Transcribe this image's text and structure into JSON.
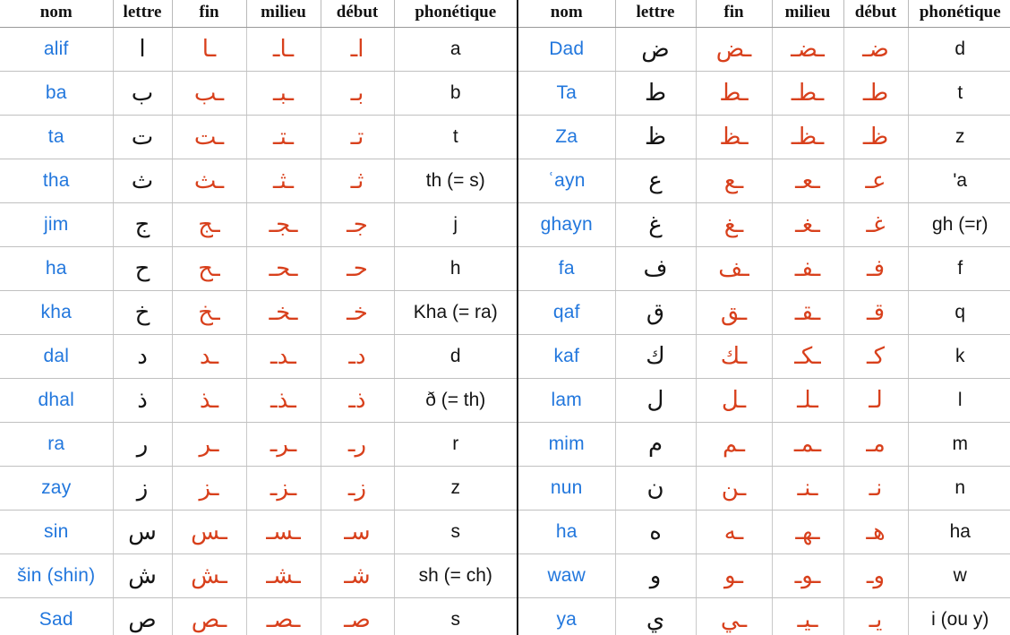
{
  "page": {
    "title": "Alphabet arabe — formes des lettres",
    "colors": {
      "name_blue": "#2277dd",
      "form_red": "#d8401c",
      "letter_black": "#141414",
      "grid_line": "#c0c0c0",
      "divider": "#1b1b1b",
      "background": "#ffffff"
    }
  },
  "headers": {
    "nom": "nom",
    "lettre": "lettre",
    "fin": "fin",
    "milieu": "milieu",
    "debut": "début",
    "phonetique": "phonétique"
  },
  "left_table": {
    "rows": [
      {
        "nom": "alif",
        "lettre": "ا",
        "fin": "ـا",
        "milieu": "ـاـ",
        "debut": "ا‍ـ",
        "phonetique": "a"
      },
      {
        "nom": "ba",
        "lettre": "ب",
        "fin": "ـب",
        "milieu": "ـبـ",
        "debut": "بـ",
        "phonetique": "b"
      },
      {
        "nom": "ta",
        "lettre": "ت",
        "fin": "ـت",
        "milieu": "ـتـ",
        "debut": "تـ",
        "phonetique": "t"
      },
      {
        "nom": "tha",
        "lettre": "ث",
        "fin": "ـث",
        "milieu": "ـثـ",
        "debut": "ثـ",
        "phonetique": "th (= s)"
      },
      {
        "nom": "jim",
        "lettre": "ج",
        "fin": "ـج",
        "milieu": "ـجـ",
        "debut": "جـ",
        "phonetique": "j"
      },
      {
        "nom": "ha",
        "lettre": "ح",
        "fin": "ـح",
        "milieu": "ـحـ",
        "debut": "حـ",
        "phonetique": "h"
      },
      {
        "nom": "kha",
        "lettre": "خ",
        "fin": "ـخ",
        "milieu": "ـخـ",
        "debut": "خـ",
        "phonetique": "Kha (= ra)"
      },
      {
        "nom": "dal",
        "lettre": "د",
        "fin": "ـد",
        "milieu": "ـدـ",
        "debut": "دـ",
        "phonetique": "d"
      },
      {
        "nom": "dhal",
        "lettre": "ذ",
        "fin": "ـذ",
        "milieu": "ـذـ",
        "debut": "ذـ",
        "phonetique": "ð (= th)"
      },
      {
        "nom": "ra",
        "lettre": "ر",
        "fin": "ـر",
        "milieu": "ـرـ",
        "debut": "رـ",
        "phonetique": "r"
      },
      {
        "nom": "zay",
        "lettre": "ز",
        "fin": "ـز",
        "milieu": "ـزـ",
        "debut": "زـ",
        "phonetique": "z"
      },
      {
        "nom": "sin",
        "lettre": "س",
        "fin": "ـس",
        "milieu": "ـسـ",
        "debut": "سـ",
        "phonetique": "s"
      },
      {
        "nom": "šin (shin)",
        "lettre": "ش",
        "fin": "ـش",
        "milieu": "ـشـ",
        "debut": "شـ",
        "phonetique": "sh (= ch)"
      },
      {
        "nom": "Sad",
        "lettre": "ص",
        "fin": "ـص",
        "milieu": "ـصـ",
        "debut": "صـ",
        "phonetique": "s"
      }
    ]
  },
  "right_table": {
    "rows": [
      {
        "nom": "Dad",
        "lettre": "ض",
        "fin": "ـض",
        "milieu": "ـضـ",
        "debut": "ضـ",
        "phonetique": "d"
      },
      {
        "nom": "Ta",
        "lettre": "ط",
        "fin": "ـط",
        "milieu": "ـطـ",
        "debut": "طـ",
        "phonetique": "t"
      },
      {
        "nom": "Za",
        "lettre": "ظ",
        "fin": "ـظ",
        "milieu": "ـظـ",
        "debut": "ظـ",
        "phonetique": "z"
      },
      {
        "nom": "ʿayn",
        "lettre": "ع",
        "fin": "ـع",
        "milieu": "ـعـ",
        "debut": "عـ",
        "phonetique": "'a"
      },
      {
        "nom": "ghayn",
        "lettre": "غ",
        "fin": "ـغ",
        "milieu": "ـغـ",
        "debut": "غـ",
        "phonetique": "gh (=r)"
      },
      {
        "nom": "fa",
        "lettre": "ف",
        "fin": "ـف",
        "milieu": "ـفـ",
        "debut": "فـ",
        "phonetique": "f"
      },
      {
        "nom": "qaf",
        "lettre": "ق",
        "fin": "ـق",
        "milieu": "ـقـ",
        "debut": "قـ",
        "phonetique": "q"
      },
      {
        "nom": "kaf",
        "lettre": "ك",
        "fin": "ـك",
        "milieu": "ـكـ",
        "debut": "كـ",
        "phonetique": "k"
      },
      {
        "nom": "lam",
        "lettre": "ل",
        "fin": "ـل",
        "milieu": "ـلـ",
        "debut": "لـ",
        "phonetique": "l"
      },
      {
        "nom": "mim",
        "lettre": "م",
        "fin": "ـم",
        "milieu": "ـمـ",
        "debut": "مـ",
        "phonetique": "m"
      },
      {
        "nom": "nun",
        "lettre": "ن",
        "fin": "ـن",
        "milieu": "ـنـ",
        "debut": "نـ",
        "phonetique": "n"
      },
      {
        "nom": "ha",
        "lettre": "ه",
        "fin": "ـه",
        "milieu": "ـهـ",
        "debut": "هـ",
        "phonetique": "ha"
      },
      {
        "nom": "waw",
        "lettre": "و",
        "fin": "ـو",
        "milieu": "ـوـ",
        "debut": "وـ",
        "phonetique": "w"
      },
      {
        "nom": "ya",
        "lettre": "ي",
        "fin": "ـي",
        "milieu": "ـيـ",
        "debut": "يـ",
        "phonetique": "i (ou y)"
      }
    ]
  }
}
